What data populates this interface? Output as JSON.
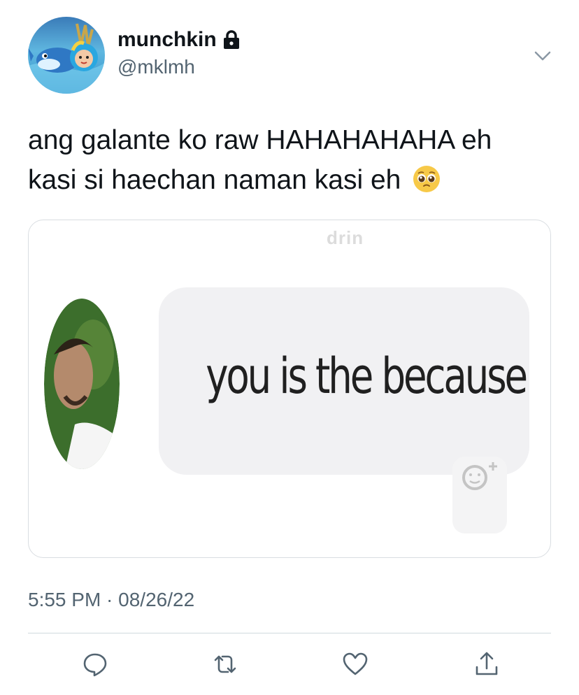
{
  "tweet": {
    "display_name": "munchkin",
    "handle": "@mklmh",
    "protected_icon": "lock-icon",
    "menu_icon": "chevron-down-icon",
    "text_line1": "ang galante ko raw HAHAHAHAHA eh",
    "text_line2": "kasi si haechan naman kasi eh",
    "emoji": "pleading-face-emoji",
    "timestamp": "5:55 PM · 08/26/22"
  },
  "media": {
    "watermark": "drin",
    "caption": "you is the because",
    "react_icon": "add-reaction-icon"
  },
  "actions": [
    {
      "name": "reply",
      "icon": "reply-icon"
    },
    {
      "name": "retweet",
      "icon": "retweet-icon"
    },
    {
      "name": "like",
      "icon": "heart-icon"
    },
    {
      "name": "share",
      "icon": "share-icon"
    }
  ],
  "colors": {
    "text": "#0f1419",
    "secondary": "#536471",
    "border": "#d9dde1"
  }
}
